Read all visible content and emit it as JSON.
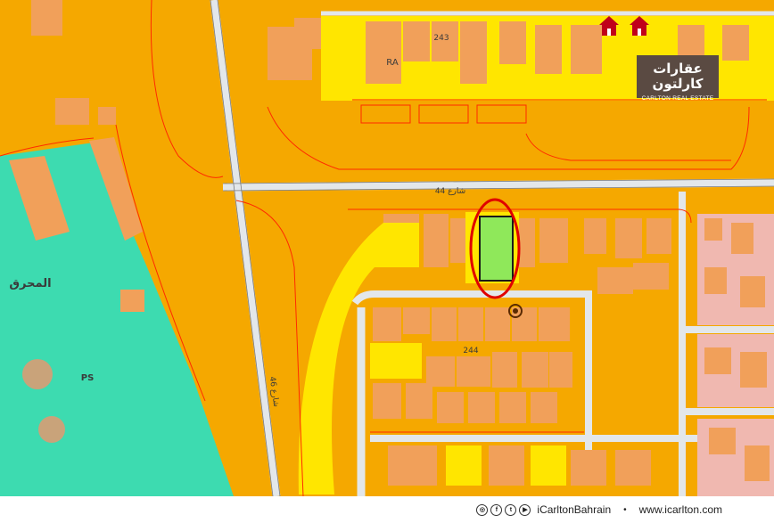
{
  "map": {
    "labels": {
      "area_name": "المحرق",
      "ps": "PS",
      "ra": "RA",
      "block_243": "243",
      "block_244": "244",
      "road_44": "شارع 44",
      "road_46": "شارع 46"
    },
    "colors": {
      "commercial": "#f5a800",
      "residential_plot": "#f1a05a",
      "open_space": "#ffe600",
      "public_service": "#3ddbb0",
      "highlighted_plot": "#8fe85a",
      "highlight_ring": "#e00000",
      "street": "#e3e7ea",
      "parcel_line": "#ff2a00",
      "pink_zone": "#f0b8b0"
    }
  },
  "logo": {
    "arabic": "عقارات كارلتون",
    "english": "CARLTON REAL ESTATE"
  },
  "footer": {
    "icons": [
      "instagram-icon",
      "facebook-icon",
      "twitter-icon",
      "youtube-icon"
    ],
    "handle": "iCarltonBahrain",
    "separator": "•",
    "website": "www.icarlton.com"
  }
}
